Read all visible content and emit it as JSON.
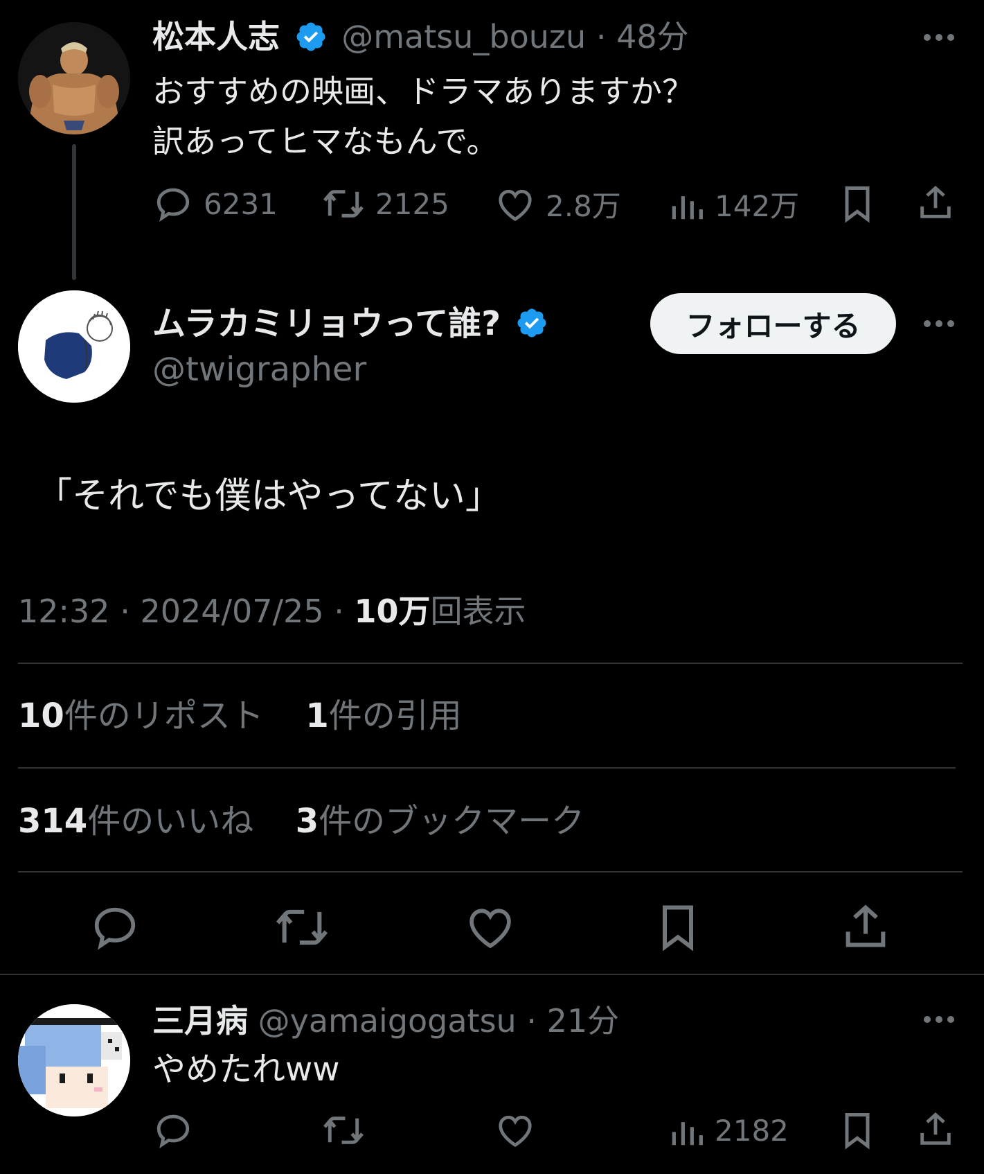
{
  "parent_tweet": {
    "author_name": "松本人志",
    "handle": "@matsu_bouzu",
    "separator": "·",
    "time": "48分",
    "text_line1": "おすすめの映画、ドラマありますか？",
    "text_line2": "訳あってヒマなもんで。",
    "replies": "6231",
    "reposts": "2125",
    "likes": "2.8万",
    "views": "142万"
  },
  "main_tweet": {
    "author_name": "ムラカミリョウって誰?",
    "handle": "@twigrapher",
    "follow_label": "フォローする",
    "text": "「それでも僕はやってない」",
    "time": "12:32",
    "date": "2024/07/25",
    "separator": "·",
    "views_count": "10万",
    "views_label": "回表示",
    "reposts_count": "10",
    "reposts_label": "件のリポスト",
    "quotes_count": "1",
    "quotes_label": "件の引用",
    "likes_count": "314",
    "likes_label": "件のいいね",
    "bookmarks_count": "3",
    "bookmarks_label": "件のブックマーク"
  },
  "reply_tweet": {
    "author_name": "三月病",
    "handle": "@yamaigogatsu",
    "separator": "·",
    "time": "21分",
    "text": "やめたれww",
    "views": "2182"
  },
  "colors": {
    "background": "#000000",
    "text_primary": "#e7e9ea",
    "text_secondary": "#71767b",
    "verified_blue": "#1d9bf0",
    "divider": "#2f3336"
  }
}
